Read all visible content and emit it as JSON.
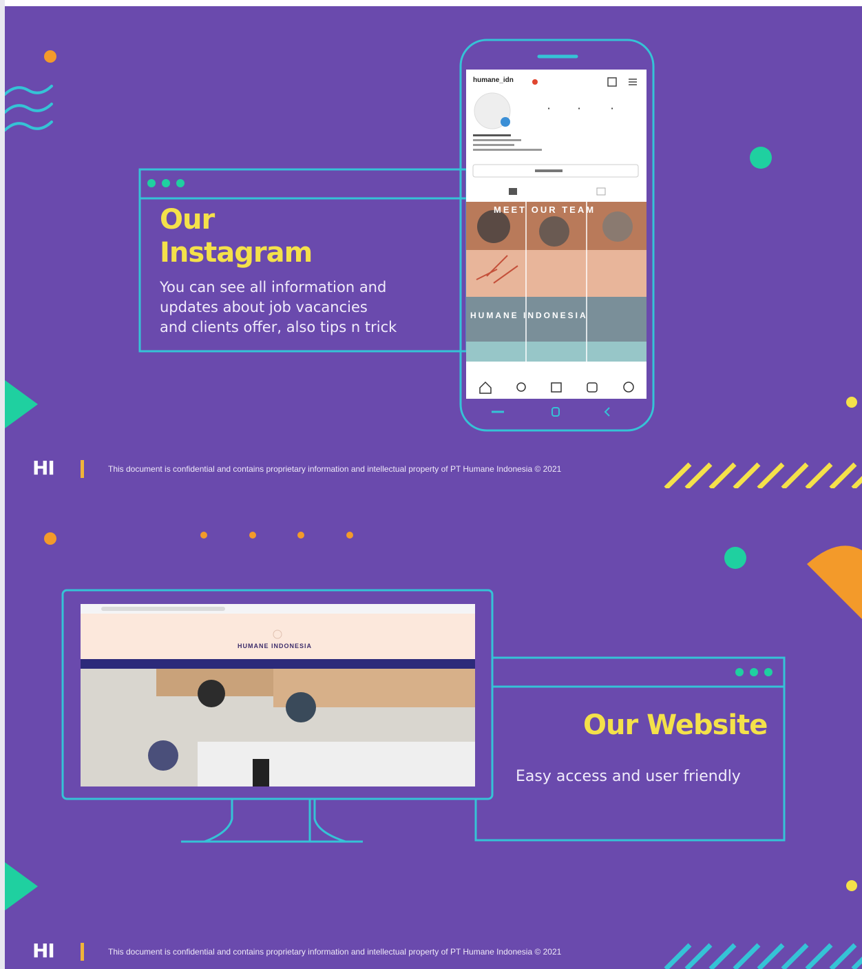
{
  "slides": [
    {
      "title_line1": "Our",
      "title_line2": "Instagram",
      "description_lines": [
        "You can see all information and",
        "updates about job vacancies",
        "and clients offer, also tips n trick"
      ],
      "instagram": {
        "username": "humane_idn",
        "banner_top": "MEET OUR TEAM",
        "banner_middle": "HUMANE INDONESIA"
      },
      "footer": {
        "logo": "HI",
        "text": "This document is confidential and contains proprietary information and intellectual property of PT Humane Indonesia © 2021"
      }
    },
    {
      "title": "Our Website",
      "description": "Easy access and user friendly",
      "website": {
        "brand": "HUMANE INDONESIA"
      },
      "footer": {
        "logo": "HI",
        "text": "This document is confidential and contains proprietary information and intellectual property of PT Humane Indonesia © 2021"
      }
    }
  ],
  "colors": {
    "background": "#6a4aad",
    "accent_cyan": "#35c3d6",
    "accent_yellow": "#f4e14a",
    "accent_orange": "#f39a2a",
    "accent_teal": "#1fd0a0"
  },
  "icons": [
    "wave-icon",
    "dot-icon",
    "triangle-icon",
    "home-icon",
    "search-icon",
    "shop-icon",
    "reels-icon",
    "profile-icon"
  ]
}
